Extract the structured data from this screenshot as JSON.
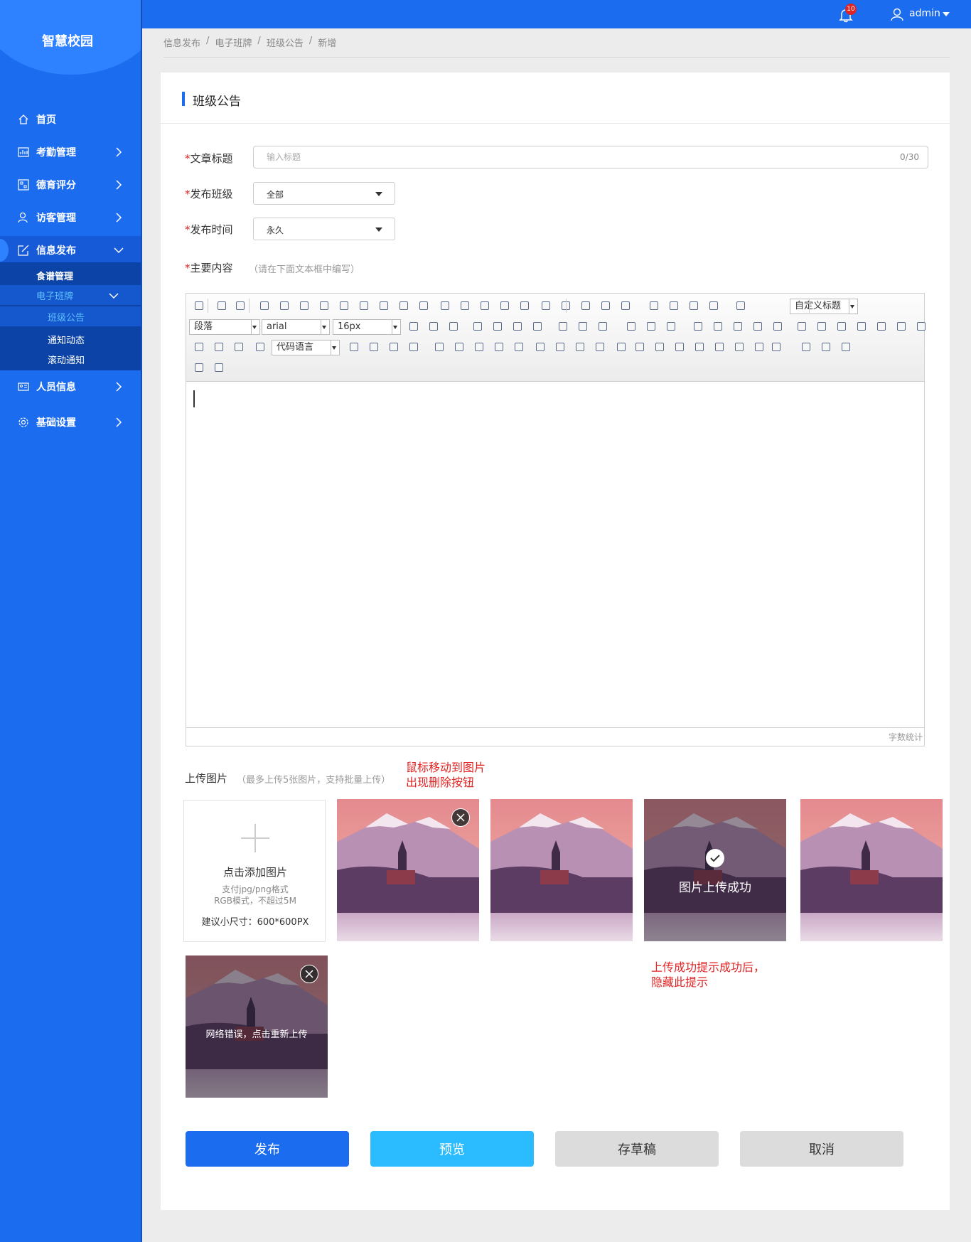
{
  "app": {
    "logo": "智慧校园"
  },
  "topbar": {
    "notifications": "10",
    "user": "admin"
  },
  "sidebar": {
    "items": [
      {
        "label": "首页"
      },
      {
        "label": "考勤管理"
      },
      {
        "label": "德育评分"
      },
      {
        "label": "访客管理"
      },
      {
        "label": "信息发布"
      },
      {
        "label": "人员信息"
      },
      {
        "label": "基础设置"
      }
    ],
    "sub": {
      "recipe": "食谱管理",
      "board": "电子班牌",
      "notice": "班级公告",
      "news": "通知动态",
      "scroll": "滚动通知"
    }
  },
  "breadcrumb": [
    "信息发布",
    "/",
    "电子班牌",
    "/",
    "班级公告",
    "/",
    "新增"
  ],
  "card": {
    "title": "班级公告"
  },
  "form": {
    "required_mark": "*",
    "title_label": "文章标题",
    "title_placeholder": "输入标题",
    "title_counter": "0/30",
    "class_label": "发布班级",
    "class_value": "全部",
    "time_label": "发布时间",
    "time_value": "永久",
    "content_label": "主要内容",
    "content_hint": "（请在下面文本框中编写）"
  },
  "editor": {
    "paragraph": "段落",
    "font": "arial",
    "size": "16px",
    "code_lang": "代码语言",
    "custom_title": "自定义标题",
    "word_count": "字数统计"
  },
  "upload": {
    "label": "上传图片",
    "hint": "（最多上传5张图片，支持批量上传）",
    "note_hover": [
      "鼠标移动到图片",
      "出现删除按钮"
    ],
    "note_success": [
      "上传成功提示成功后，",
      "隐藏此提示"
    ],
    "add_title": "点击添加图片",
    "add_desc1": "支付jpg/png格式",
    "add_desc2": "RGB模式，不超过5M",
    "add_size": "建议小尺寸：600*600PX",
    "success_text": "图片上传成功",
    "error_text": "网络错误，点击重新上传"
  },
  "actions": {
    "publish": "发布",
    "preview": "预览",
    "draft": "存草稿",
    "cancel": "取消"
  },
  "colors": {
    "primary": "#1b6cee",
    "preview": "#2bbcff",
    "danger": "#e02424",
    "grey_button": "#dcdcdc"
  }
}
